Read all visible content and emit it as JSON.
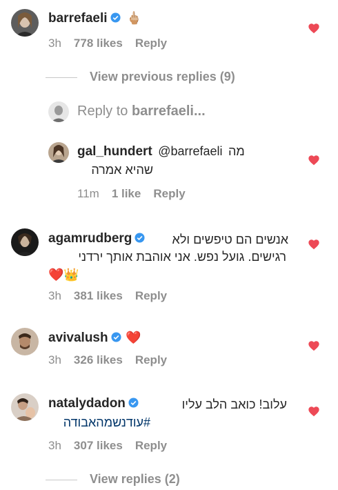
{
  "comments": [
    {
      "username": "barrefaeli",
      "verified": true,
      "emoji": "🖕🏼",
      "time": "3h",
      "likes": "778 likes",
      "reply": "Reply"
    },
    {
      "username": "agamrudberg",
      "verified": true,
      "text_line1": "אנשים הם טיפשים ולא",
      "text_line2": "רגישים. גועל נפש. אני אוהבת אותך ירדני",
      "emoji": "❤️👑",
      "time": "3h",
      "likes": "381 likes",
      "reply": "Reply"
    },
    {
      "username": "avivalush",
      "verified": true,
      "emoji": "❤️",
      "time": "3h",
      "likes": "326 likes",
      "reply": "Reply"
    },
    {
      "username": "natalydadon",
      "verified": true,
      "text_line1": "עלוב! כואב הלב עליו",
      "text_line2": "#עודנשמהאבודה",
      "time": "3h",
      "likes": "307 likes",
      "reply": "Reply"
    }
  ],
  "view_previous_replies": "View previous replies (9)",
  "reply_box": {
    "placeholder_prefix": "Reply to ",
    "placeholder_user": "barrefaeli..."
  },
  "reply_comment": {
    "username": "gal_hundert",
    "mention": "@barrefaeli",
    "text_inline": "מה",
    "text_line2": "שהיא אמרה",
    "time": "11m",
    "likes": "1 like",
    "reply": "Reply"
  },
  "view_replies": "View replies (2)",
  "colors": {
    "heart": "#ed4956",
    "verified": "#3897f0",
    "meta": "#8e8e8e",
    "link": "#003569"
  }
}
